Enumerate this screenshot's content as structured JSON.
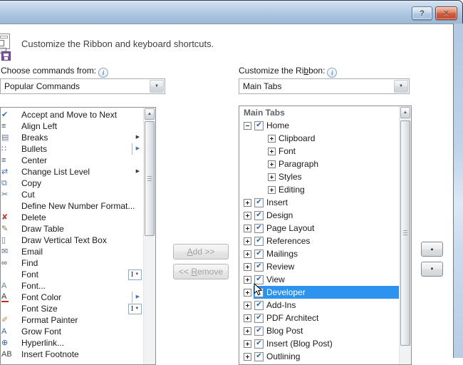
{
  "window": {
    "help_glyph": "?",
    "close_glyph": "✕"
  },
  "header": {
    "description": "Customize the Ribbon and keyboard shortcuts."
  },
  "glyphs": {
    "info": "i",
    "dropdown_arrow": "▼",
    "up_arrow": "▲",
    "down_arrow": "▼",
    "submenu_arrow": "▶",
    "check": "✔",
    "combo_ibeam": "I",
    "combo_ibeam_arrow": "▼"
  },
  "colors": {
    "selection": "#2D93EE",
    "selection_text": "#FFFFFF",
    "check": "#2D5FA8"
  },
  "left_panel": {
    "label": "Choose commands from:",
    "dropdown_value": "Popular Commands",
    "commands": [
      {
        "label": "Accept and Move to Next",
        "icon": "accept-icon",
        "glyph": "✔",
        "color": "#2e6db5"
      },
      {
        "label": "Align Left",
        "icon": "align-left-icon",
        "glyph": "≡",
        "color": "#44536b"
      },
      {
        "label": "Breaks",
        "icon": "page-break-icon",
        "glyph": "▤",
        "color": "#6b7a99",
        "submenu": true
      },
      {
        "label": "Bullets",
        "icon": "bullets-icon",
        "glyph": "∷",
        "color": "#33415c",
        "submenu": true,
        "hot": true
      },
      {
        "label": "Center",
        "icon": "center-icon",
        "glyph": "≡",
        "color": "#44536b"
      },
      {
        "label": "Change List Level",
        "icon": "change-list-level-icon",
        "glyph": "⇄",
        "color": "#3e6fb0",
        "submenu": true
      },
      {
        "label": "Copy",
        "icon": "copy-icon",
        "glyph": "⧉",
        "color": "#5577a0"
      },
      {
        "label": "Cut",
        "icon": "cut-icon",
        "glyph": "✂",
        "color": "#5a6a85"
      },
      {
        "label": "Define New Number Format...",
        "icon": "",
        "glyph": "",
        "color": ""
      },
      {
        "label": "Delete",
        "icon": "delete-icon",
        "glyph": "✘",
        "color": "#c23b2e"
      },
      {
        "label": "Draw Table",
        "icon": "draw-table-icon",
        "glyph": "✎",
        "color": "#8a6d3b"
      },
      {
        "label": "Draw Vertical Text Box",
        "icon": "draw-vertical-text-box-icon",
        "glyph": "▯",
        "color": "#5a6a85"
      },
      {
        "label": "Email",
        "icon": "email-icon",
        "glyph": "✉",
        "color": "#5a6a85"
      },
      {
        "label": "Find",
        "icon": "find-icon",
        "glyph": "∞",
        "color": "#3c4660"
      },
      {
        "label": "Font",
        "icon": "",
        "glyph": "",
        "color": "",
        "combo": true
      },
      {
        "label": "Font...",
        "icon": "font-dialog-icon",
        "glyph": "A",
        "color": "#6b7a8f"
      },
      {
        "label": "Font Color",
        "icon": "font-color-icon",
        "glyph": "A",
        "color": "#333333",
        "submenu": true,
        "hot": true
      },
      {
        "label": "Font Size",
        "icon": "",
        "glyph": "",
        "color": "",
        "combo": true
      },
      {
        "label": "Format Painter",
        "icon": "format-painter-icon",
        "glyph": "✐",
        "color": "#b8863e"
      },
      {
        "label": "Grow Font",
        "icon": "grow-font-icon",
        "glyph": "A",
        "color": "#3465a4"
      },
      {
        "label": "Hyperlink...",
        "icon": "hyperlink-icon",
        "glyph": "⊕",
        "color": "#3465a4"
      },
      {
        "label": "Insert Footnote",
        "icon": "insert-footnote-icon",
        "glyph": "AB¹",
        "color": "#444444"
      }
    ]
  },
  "middle_buttons": {
    "add_pre": "",
    "add_key": "A",
    "add_post": "dd >>",
    "remove_pre": "<< ",
    "remove_key": "R",
    "remove_post": "emove"
  },
  "right_panel": {
    "label_pre": "Customize the Ri",
    "label_key": "b",
    "label_post": "bon:",
    "dropdown_value": "Main Tabs",
    "tree_header": "Main Tabs",
    "items": [
      {
        "label": "Home",
        "level": 0,
        "expand": "minus",
        "checkbox": true,
        "checked": true
      },
      {
        "label": "Clipboard",
        "level": 1,
        "expand": "plus"
      },
      {
        "label": "Font",
        "level": 1,
        "expand": "plus"
      },
      {
        "label": "Paragraph",
        "level": 1,
        "expand": "plus"
      },
      {
        "label": "Styles",
        "level": 1,
        "expand": "plus"
      },
      {
        "label": "Editing",
        "level": 1,
        "expand": "plus"
      },
      {
        "label": "Insert",
        "level": 0,
        "expand": "plus",
        "checkbox": true,
        "checked": true
      },
      {
        "label": "Design",
        "level": 0,
        "expand": "plus",
        "checkbox": true,
        "checked": true
      },
      {
        "label": "Page Layout",
        "level": 0,
        "expand": "plus",
        "checkbox": true,
        "checked": true
      },
      {
        "label": "References",
        "level": 0,
        "expand": "plus",
        "checkbox": true,
        "checked": true
      },
      {
        "label": "Mailings",
        "level": 0,
        "expand": "plus",
        "checkbox": true,
        "checked": true
      },
      {
        "label": "Review",
        "level": 0,
        "expand": "plus",
        "checkbox": true,
        "checked": true
      },
      {
        "label": "View",
        "level": 0,
        "expand": "plus",
        "checkbox": true,
        "checked": true
      },
      {
        "label": "Developer",
        "level": 0,
        "expand": "plus",
        "checkbox": true,
        "checked": true,
        "selected": true
      },
      {
        "label": "Add-Ins",
        "level": 0,
        "expand": "plus",
        "checkbox": true,
        "checked": true
      },
      {
        "label": "PDF Architect",
        "level": 0,
        "expand": "plus",
        "checkbox": true,
        "checked": true
      },
      {
        "label": "Blog Post",
        "level": 0,
        "expand": "plus",
        "checkbox": true,
        "checked": true
      },
      {
        "label": "Insert (Blog Post)",
        "level": 0,
        "expand": "plus",
        "checkbox": true,
        "checked": true
      },
      {
        "label": "Outlining",
        "level": 0,
        "expand": "plus",
        "checkbox": true,
        "checked": true
      }
    ]
  }
}
